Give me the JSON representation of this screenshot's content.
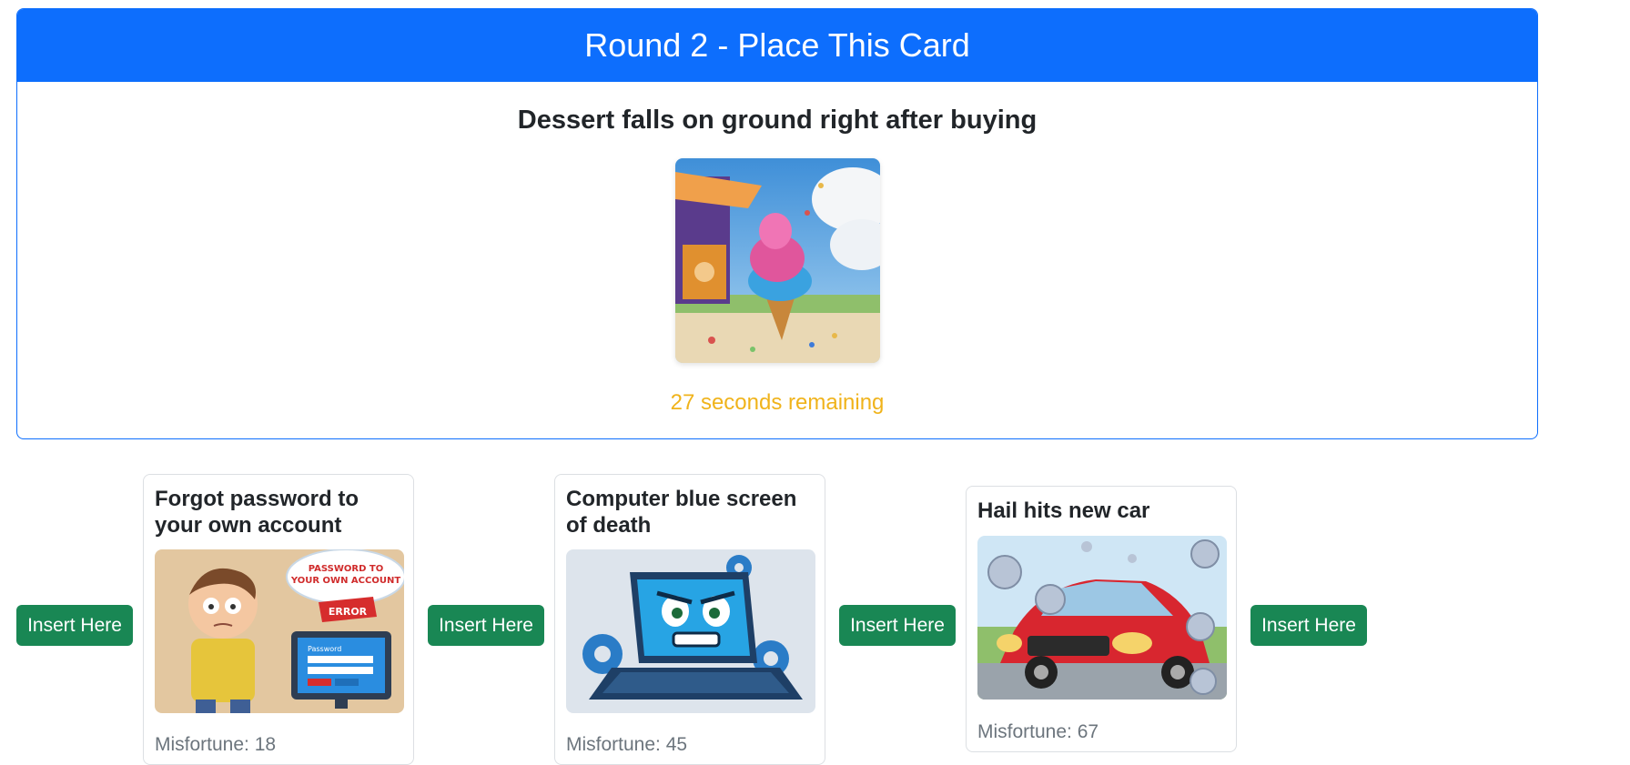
{
  "round": {
    "header": "Round 2 - Place This Card",
    "card_title": "Dessert falls on ground right after buying",
    "timer": "27 seconds remaining"
  },
  "insert_label": "Insert Here",
  "timeline": [
    {
      "title": "Forgot password to your own account",
      "misfortune": "Misfortune: 18"
    },
    {
      "title": "Computer blue screen of death",
      "misfortune": "Misfortune: 45"
    },
    {
      "title": "Hail hits new car",
      "misfortune": "Misfortune: 67"
    }
  ],
  "illustration_text": {
    "forgot_bubble": "PASSWORD TO YOUR OWN ACCOUNT",
    "forgot_error": "ERROR",
    "forgot_screen": "Password"
  },
  "colors": {
    "primary": "#0d6efd",
    "success": "#198754",
    "warning": "#f0b31b"
  }
}
